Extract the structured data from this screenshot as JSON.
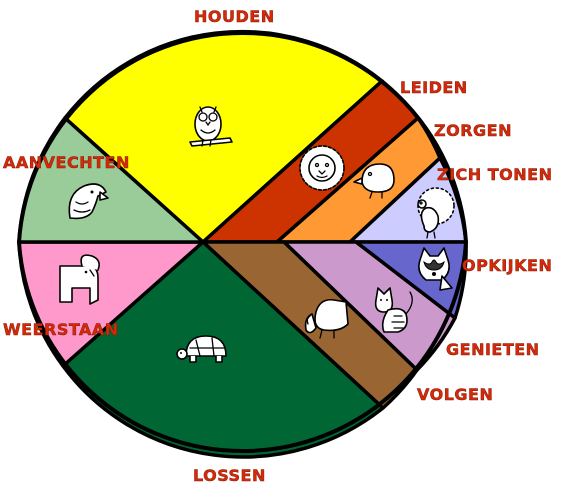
{
  "title": "",
  "segments": [
    {
      "id": "houden",
      "label": "HOUDEN",
      "color": "#ffff00",
      "animal": "owl-icon"
    },
    {
      "id": "leiden",
      "label": "LEIDEN",
      "color": "#cc3300",
      "animal": "lion-icon"
    },
    {
      "id": "zorgen",
      "label": "ZORGEN",
      "color": "#ff9933",
      "animal": "bird-icon"
    },
    {
      "id": "zich-tonen",
      "label": "ZICH TONEN",
      "color": "#ccccff",
      "animal": "peacock-icon"
    },
    {
      "id": "opkijken",
      "label": "OPKIJKEN",
      "color": "#6666cc",
      "animal": "raccoon-icon"
    },
    {
      "id": "genieten",
      "label": "GENIETEN",
      "color": "#cc99cc",
      "animal": "cat-icon"
    },
    {
      "id": "volgen",
      "label": "VOLGEN",
      "color": "#996633",
      "animal": "dog-icon"
    },
    {
      "id": "lossen",
      "label": "LOSSEN",
      "color": "#006633",
      "animal": "turtle-icon"
    },
    {
      "id": "weerstaan",
      "label": "WEERSTAAN",
      "color": "#ff99cc",
      "animal": "goat-icon"
    },
    {
      "id": "aanvechten",
      "label": "AANVECHTEN",
      "color": "#99cc99",
      "animal": "eagle-icon"
    }
  ],
  "label_color": "#d42a0a"
}
